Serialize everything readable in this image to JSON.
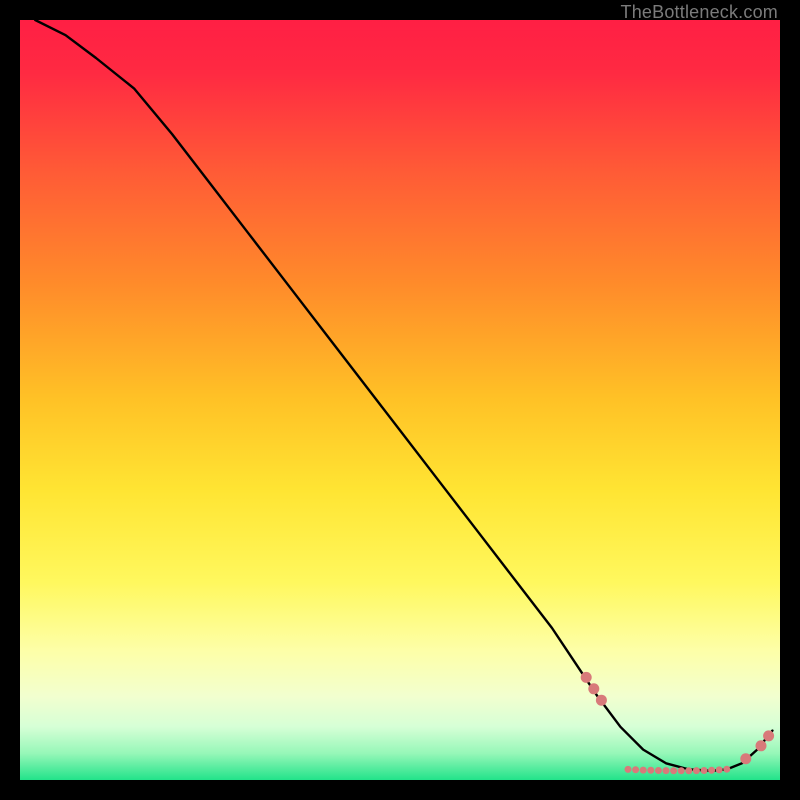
{
  "watermark": "TheBottleneck.com",
  "chart_data": {
    "type": "line",
    "title": "",
    "xlabel": "",
    "ylabel": "",
    "xlim": [
      0,
      100
    ],
    "ylim": [
      0,
      100
    ],
    "grid": false,
    "background_gradient": {
      "top": "#ff2245",
      "upper_mid": "#ff8a2a",
      "mid": "#ffe727",
      "lower_mid": "#f6ffb0",
      "bottom": "#2fe78a"
    },
    "series": [
      {
        "name": "bottleneck-curve",
        "color": "#000000",
        "x": [
          2,
          6,
          10,
          15,
          20,
          25,
          30,
          35,
          40,
          45,
          50,
          55,
          60,
          65,
          70,
          73,
          76,
          79,
          82,
          85,
          88,
          91,
          93,
          95,
          97,
          99
        ],
        "y": [
          100,
          98,
          95,
          91,
          85,
          78.5,
          72,
          65.5,
          59,
          52.5,
          46,
          39.5,
          33,
          26.5,
          20,
          15.5,
          11,
          7,
          4,
          2.2,
          1.4,
          1.2,
          1.4,
          2.2,
          4,
          6.5
        ]
      }
    ],
    "markers": [
      {
        "name": "highlight-dots",
        "color": "#d87a7a",
        "radius_large": 5.5,
        "radius_small": 3.5,
        "points_large": [
          {
            "x": 74.5,
            "y": 13.5
          },
          {
            "x": 75.5,
            "y": 12.0
          },
          {
            "x": 76.5,
            "y": 10.5
          },
          {
            "x": 95.5,
            "y": 2.8
          },
          {
            "x": 97.5,
            "y": 4.5
          },
          {
            "x": 98.5,
            "y": 5.8
          }
        ],
        "points_small": [
          {
            "x": 80,
            "y": 1.4
          },
          {
            "x": 81,
            "y": 1.35
          },
          {
            "x": 82,
            "y": 1.3
          },
          {
            "x": 83,
            "y": 1.28
          },
          {
            "x": 84,
            "y": 1.25
          },
          {
            "x": 85,
            "y": 1.23
          },
          {
            "x": 86,
            "y": 1.22
          },
          {
            "x": 87,
            "y": 1.22
          },
          {
            "x": 88,
            "y": 1.22
          },
          {
            "x": 89,
            "y": 1.23
          },
          {
            "x": 90,
            "y": 1.25
          },
          {
            "x": 91,
            "y": 1.28
          },
          {
            "x": 92,
            "y": 1.33
          },
          {
            "x": 93,
            "y": 1.42
          }
        ]
      }
    ]
  }
}
